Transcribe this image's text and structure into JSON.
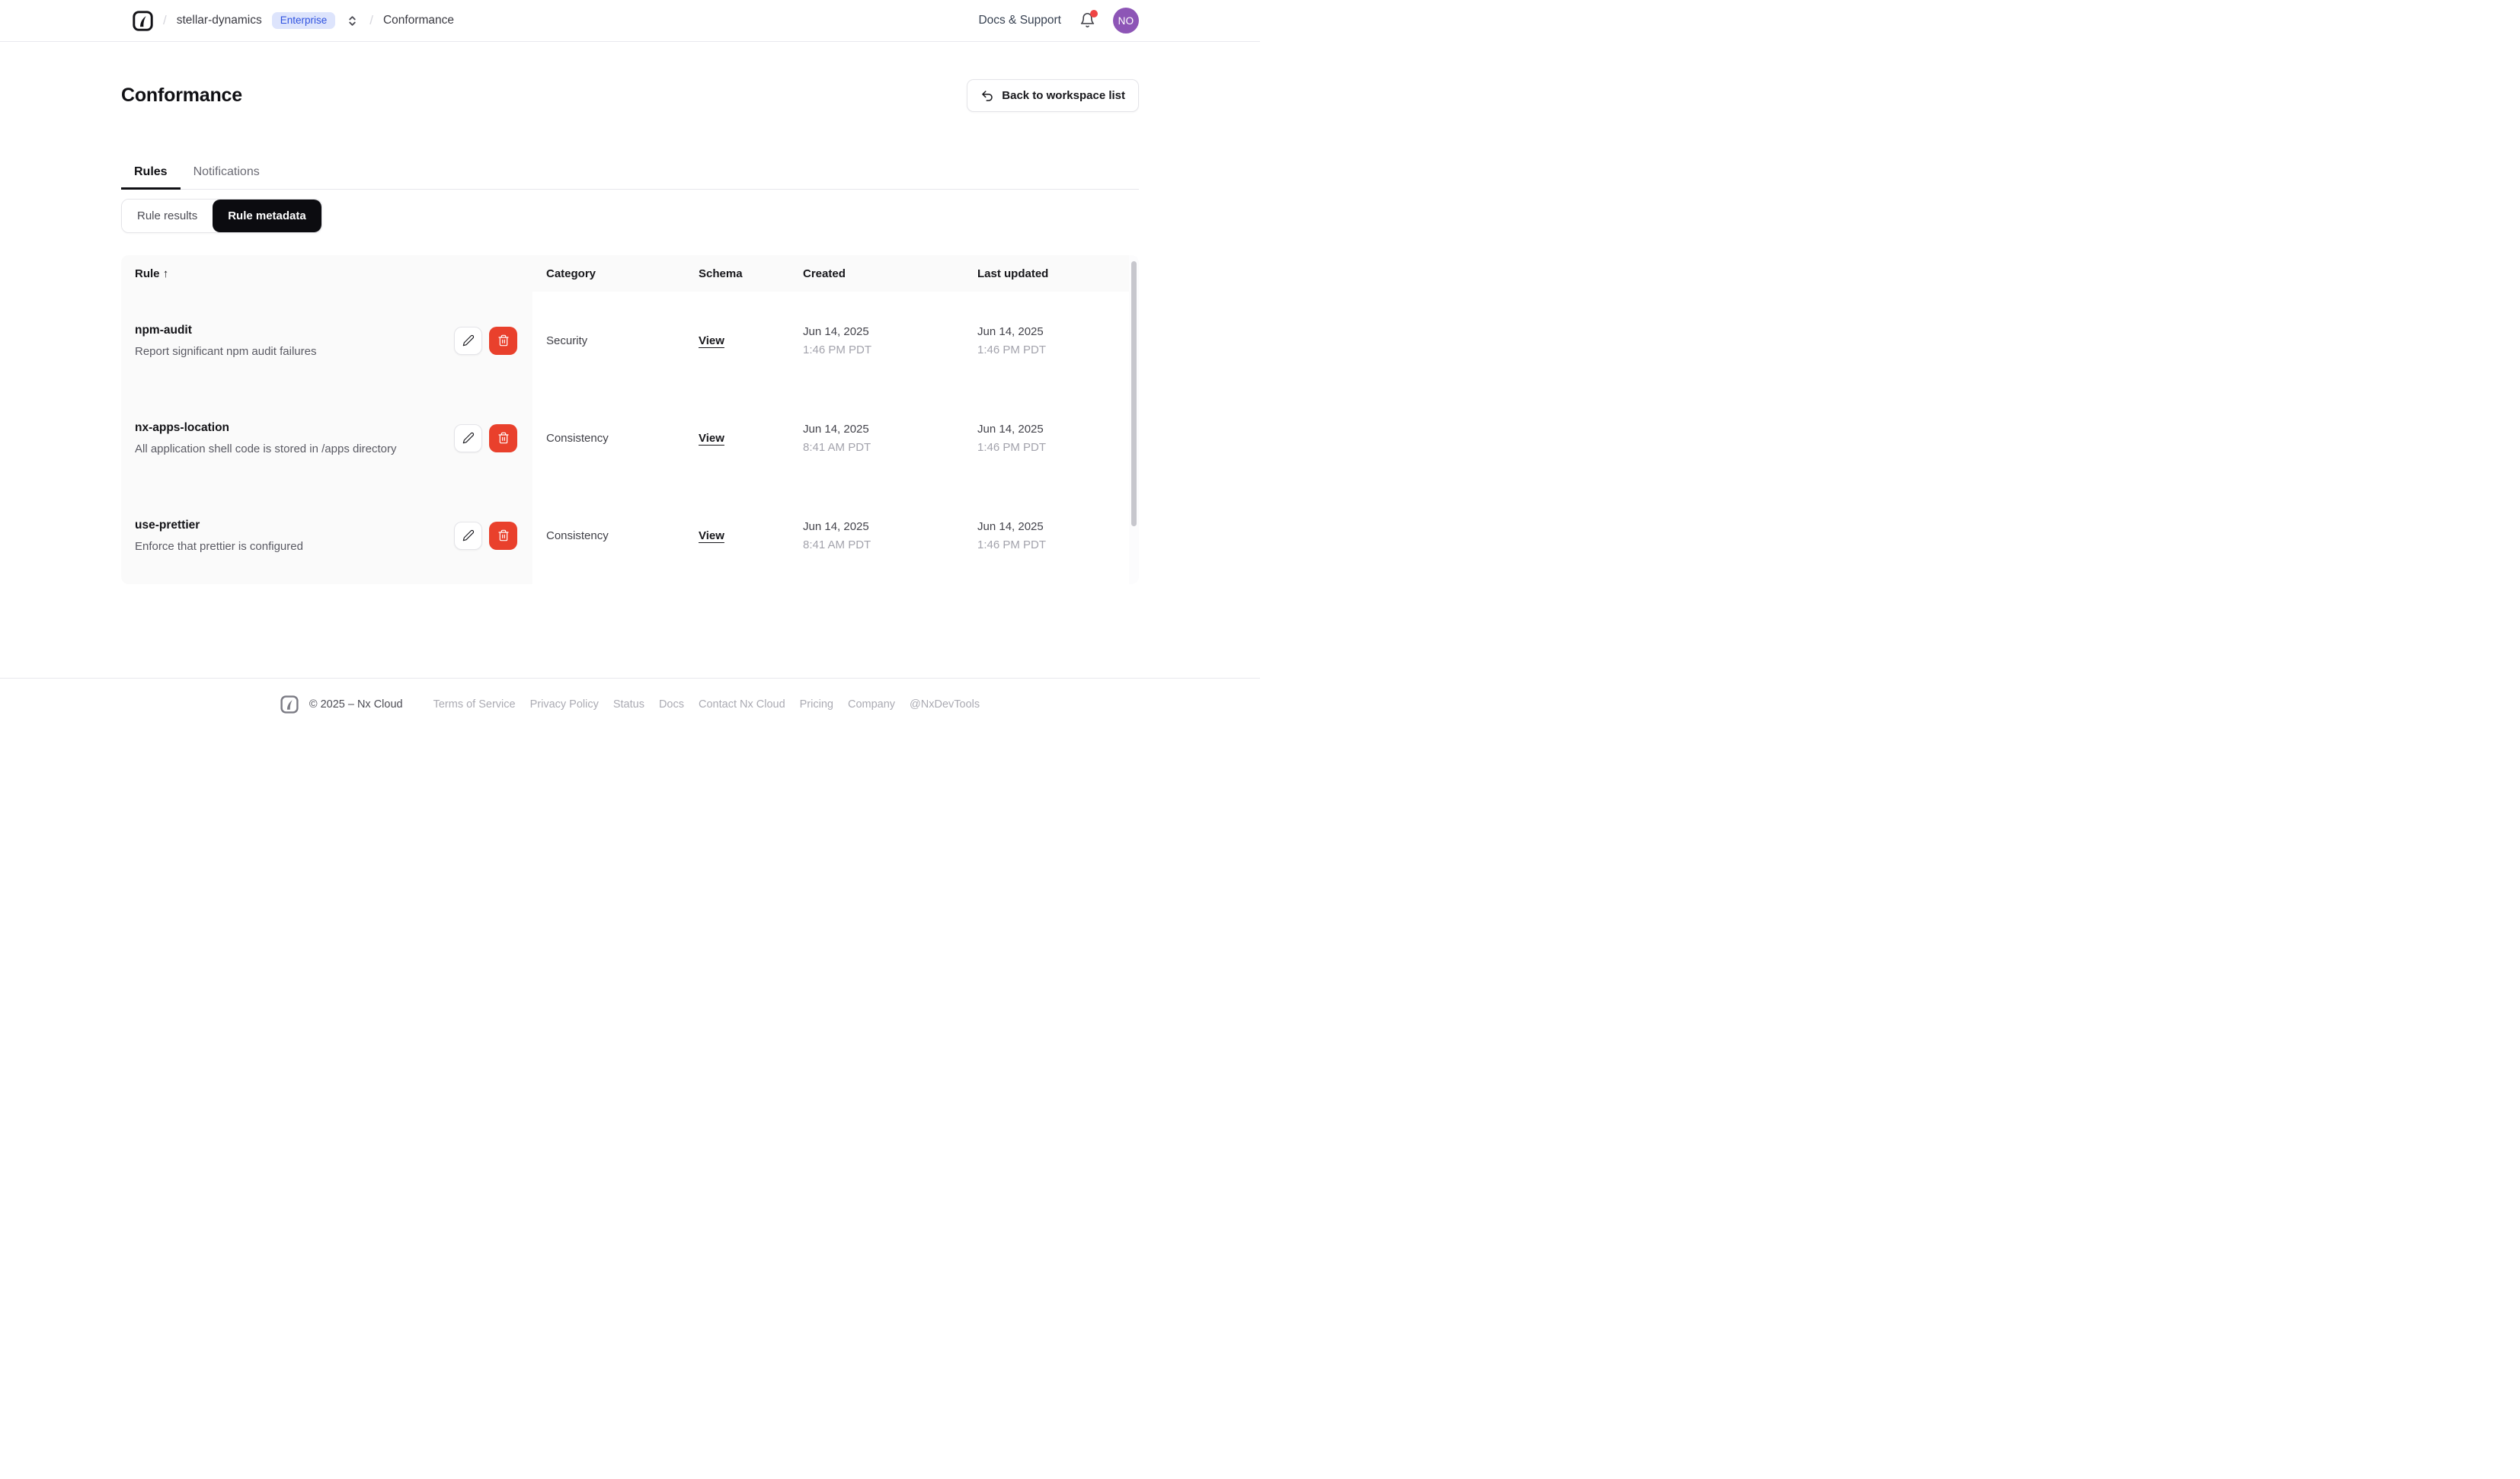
{
  "colors": {
    "badge-bg": "#dde4fc",
    "badge-text": "#2f52e0",
    "avatar-bg": "#8d55b6",
    "alert-red": "#ef4444",
    "delete-red": "#e9402c",
    "active-pill": "#0c0c10"
  },
  "nav": {
    "breadcrumb": {
      "separator": "/",
      "org": "stellar-dynamics",
      "badge": "Enterprise",
      "page": "Conformance"
    },
    "docs_support": "Docs & Support",
    "avatar_initials": "NO"
  },
  "page": {
    "title": "Conformance",
    "back_button": "Back to workspace list"
  },
  "tabs": {
    "rules": "Rules",
    "notifications": "Notifications"
  },
  "segmented": {
    "results": "Rule results",
    "metadata": "Rule metadata"
  },
  "table": {
    "columns": {
      "rule": "Rule",
      "sort_indicator": "↑",
      "category": "Category",
      "schema": "Schema",
      "created": "Created",
      "last_updated": "Last updated"
    },
    "rows": [
      {
        "name": "npm-audit",
        "description": "Report significant npm audit failures",
        "category": "Security",
        "schema_link": "View",
        "created_date": "Jun 14, 2025",
        "created_time": "1:46 PM PDT",
        "updated_date": "Jun 14, 2025",
        "updated_time": "1:46 PM PDT"
      },
      {
        "name": "nx-apps-location",
        "description": "All application shell code is stored in /apps directory",
        "category": "Consistency",
        "schema_link": "View",
        "created_date": "Jun 14, 2025",
        "created_time": "8:41 AM PDT",
        "updated_date": "Jun 14, 2025",
        "updated_time": "1:46 PM PDT"
      },
      {
        "name": "use-prettier",
        "description": "Enforce that prettier is configured",
        "category": "Consistency",
        "schema_link": "View",
        "created_date": "Jun 14, 2025",
        "created_time": "8:41 AM PDT",
        "updated_date": "Jun 14, 2025",
        "updated_time": "1:46 PM PDT"
      }
    ]
  },
  "footer": {
    "copyright": "© 2025 – Nx Cloud",
    "links": [
      "Terms of Service",
      "Privacy Policy",
      "Status",
      "Docs",
      "Contact Nx Cloud",
      "Pricing",
      "Company",
      "@NxDevTools"
    ]
  }
}
